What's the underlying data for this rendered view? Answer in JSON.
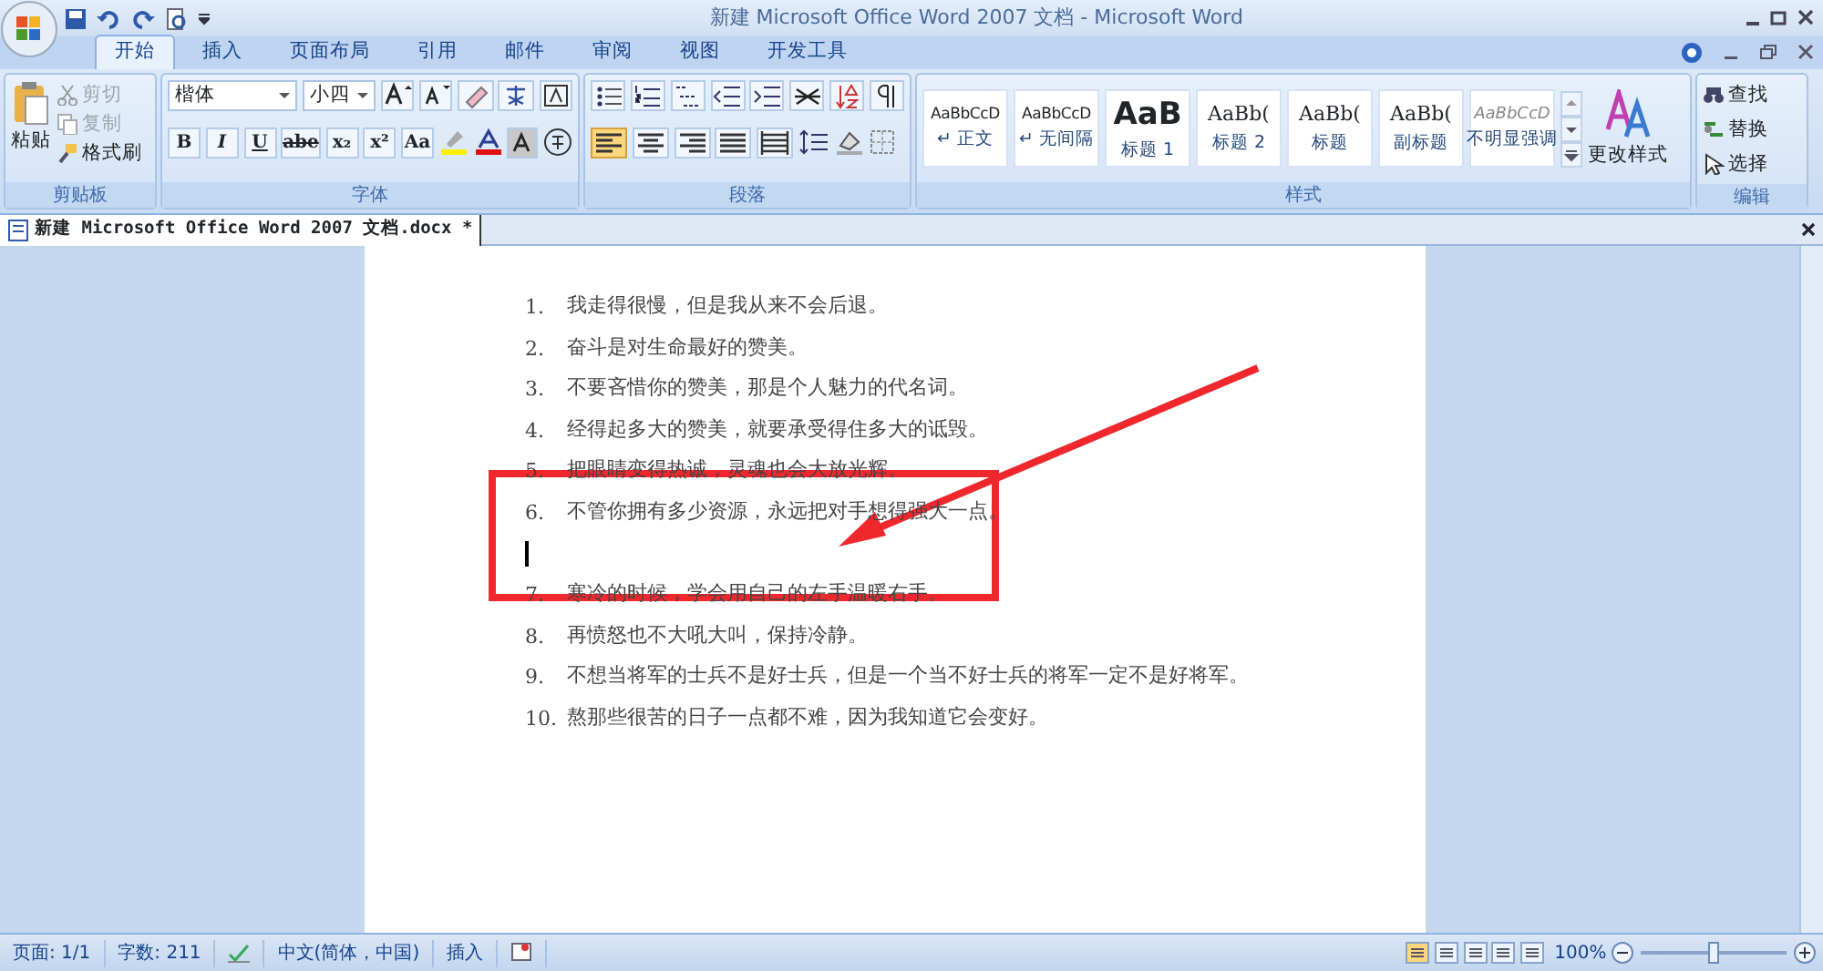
{
  "window": {
    "title": "新建 Microsoft Office Word 2007 文档 - Microsoft Word"
  },
  "tabs": [
    {
      "label": "开始",
      "selected": true
    },
    {
      "label": "插入",
      "selected": false
    },
    {
      "label": "页面布局",
      "selected": false
    },
    {
      "label": "引用",
      "selected": false
    },
    {
      "label": "邮件",
      "selected": false
    },
    {
      "label": "审阅",
      "selected": false
    },
    {
      "label": "视图",
      "selected": false
    },
    {
      "label": "开发工具",
      "selected": false
    }
  ],
  "clipboard": {
    "label": "剪贴板",
    "paste": "粘贴",
    "items": [
      {
        "label": "剪切",
        "disabled": true
      },
      {
        "label": "复制",
        "disabled": true
      },
      {
        "label": "格式刷",
        "disabled": false
      }
    ]
  },
  "font": {
    "label": "字体",
    "font_name": "楷体",
    "font_size": "小四",
    "format_buttons": [
      "B",
      "I",
      "U",
      "abe",
      "x₂",
      "x²",
      "Aa"
    ]
  },
  "paragraph": {
    "label": "段落",
    "alignments": [
      {
        "kind": "left",
        "selected": true
      },
      {
        "kind": "center",
        "selected": false
      },
      {
        "kind": "right",
        "selected": false
      },
      {
        "kind": "justify",
        "selected": false
      },
      {
        "kind": "distributed",
        "selected": false
      }
    ]
  },
  "styles": {
    "label": "样式",
    "change_styles": "更改样式",
    "items": [
      {
        "preview": "AaBbCcD",
        "label": "↵ 正文",
        "kind": "normal"
      },
      {
        "preview": "AaBbCcD",
        "label": "↵ 无间隔",
        "kind": "normal"
      },
      {
        "preview": "AaB",
        "label": "标题 1",
        "kind": "heading"
      },
      {
        "preview": "AaBb(",
        "label": "标题 2",
        "kind": "serif"
      },
      {
        "preview": "AaBb(",
        "label": "标题",
        "kind": "serif"
      },
      {
        "preview": "AaBb(",
        "label": "副标题",
        "kind": "serif"
      },
      {
        "preview": "AaBbCcD",
        "label": "不明显强调",
        "kind": "subtle"
      }
    ]
  },
  "editing": {
    "label": "编辑",
    "items": [
      "查找",
      "替换",
      "选择"
    ]
  },
  "document_tab": {
    "title": "新建 Microsoft Office Word 2007 文档.docx *"
  },
  "document": {
    "lines": [
      {
        "number": "1.",
        "text": "我走得很慢，但是我从来不会后退。"
      },
      {
        "number": "2.",
        "text": "奋斗是对生命最好的赞美。"
      },
      {
        "number": "3.",
        "text": "不要吝惜你的赞美，那是个人魅力的代名词。"
      },
      {
        "number": "4.",
        "text": "经得起多大的赞美，就要承受得住多大的诋毁。"
      },
      {
        "number": "5.",
        "text": "把眼睛变得热诚，灵魂也会大放光辉。"
      },
      {
        "number": "6.",
        "text": "不管你拥有多少资源，永远把对手想得强大一点。"
      },
      {
        "kind": "cursor"
      },
      {
        "number": "7.",
        "text": "寒冷的时候，学会用自己的左手温暖右手。"
      },
      {
        "number": "8.",
        "text": "再愤怒也不大吼大叫，保持冷静。"
      },
      {
        "number": "9.",
        "text": "不想当将军的士兵不是好士兵，但是一个当不好士兵的将军一定不是好将军。"
      },
      {
        "number": "10.",
        "text": "熬那些很苦的日子一点都不难，因为我知道它会变好。"
      }
    ]
  },
  "status_bar": {
    "page": "页面: 1/1",
    "words": "字数: 211",
    "language": "中文(简体，中国)",
    "mode": "插入",
    "zoom": "100%",
    "zoom_slider": {
      "level": 0.5
    }
  }
}
